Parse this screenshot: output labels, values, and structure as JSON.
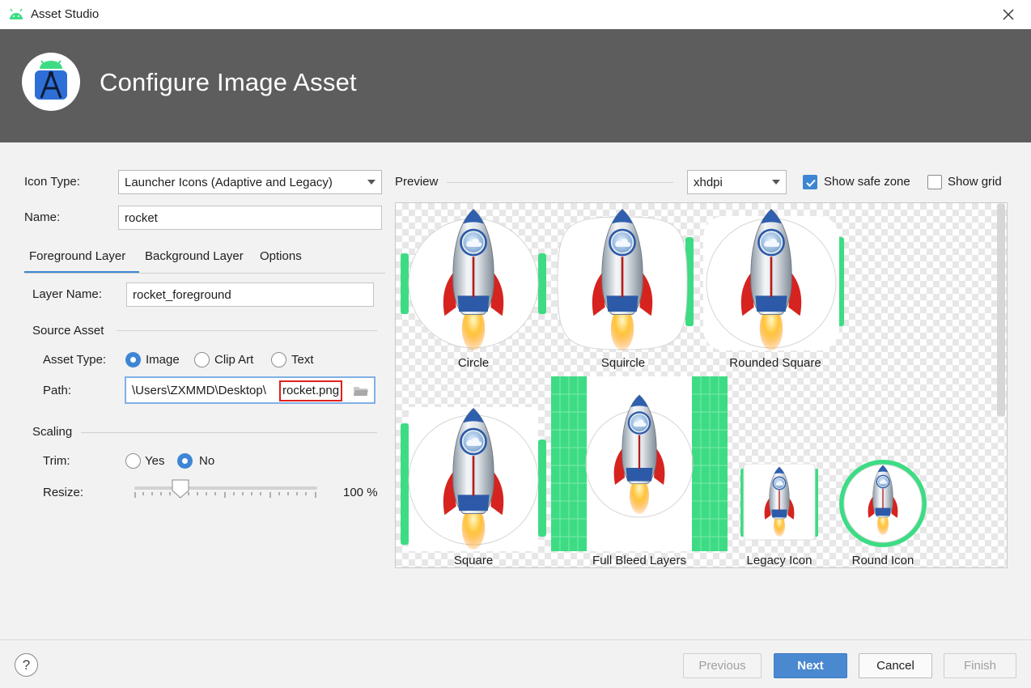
{
  "window": {
    "title": "Asset Studio",
    "close_icon": "close-icon"
  },
  "header": {
    "title": "Configure Image Asset",
    "logo_icon": "android-studio-logo"
  },
  "form": {
    "icon_type_label": "Icon Type:",
    "icon_type_value": "Launcher Icons (Adaptive and Legacy)",
    "name_label": "Name:",
    "name_value": "rocket",
    "tabs": [
      {
        "label": "Foreground Layer",
        "active": true
      },
      {
        "label": "Background Layer",
        "active": false
      },
      {
        "label": "Options",
        "active": false
      }
    ],
    "layer_name_label": "Layer Name:",
    "layer_name_value": "rocket_foreground",
    "source_asset_label": "Source Asset",
    "asset_type_label": "Asset Type:",
    "asset_types": [
      {
        "label": "Image",
        "selected": true
      },
      {
        "label": "Clip Art",
        "selected": false
      },
      {
        "label": "Text",
        "selected": false
      }
    ],
    "path_label": "Path:",
    "path_prefix": "\\Users\\ZXMMD\\Desktop\\",
    "path_filename": "rocket.png",
    "scaling_label": "Scaling",
    "trim_label": "Trim:",
    "trim_options": [
      {
        "label": "Yes",
        "selected": false
      },
      {
        "label": "No",
        "selected": true
      }
    ],
    "resize_label": "Resize:",
    "resize_value": "100 %",
    "resize_percent": 100
  },
  "preview": {
    "label": "Preview",
    "density": "xhdpi",
    "show_safe_zone_label": "Show safe zone",
    "show_safe_zone": true,
    "show_grid_label": "Show grid",
    "show_grid": false,
    "items": [
      {
        "label": "Circle"
      },
      {
        "label": "Squircle"
      },
      {
        "label": "Rounded Square"
      },
      {
        "label": "Square"
      },
      {
        "label": "Full Bleed Layers"
      },
      {
        "label": "Legacy Icon"
      },
      {
        "label": "Round Icon"
      }
    ]
  },
  "footer": {
    "help_label": "?",
    "previous_label": "Previous",
    "next_label": "Next",
    "cancel_label": "Cancel",
    "finish_label": "Finish"
  },
  "colors": {
    "accent": "#3d86d4",
    "header_bg": "#5d5d5d",
    "safe_zone_green": "#3ddc84",
    "highlight_red": "#e0201c"
  }
}
